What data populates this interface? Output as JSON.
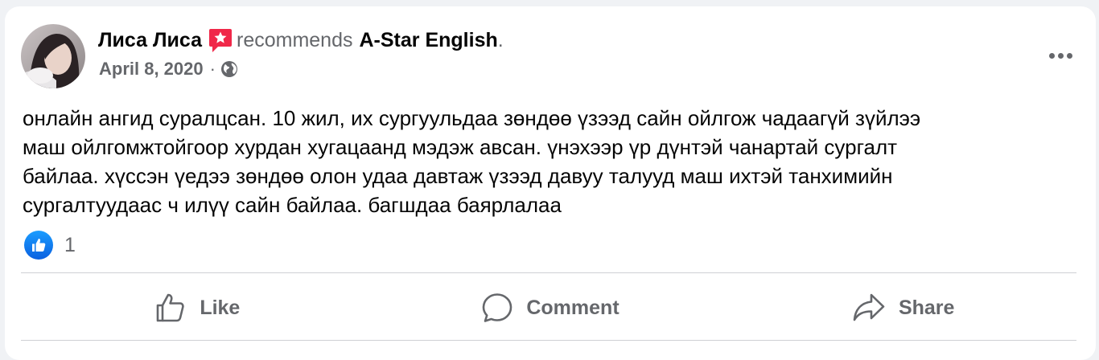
{
  "post": {
    "author": "Лиса Лиса",
    "verb": "recommends",
    "page": "A-Star English",
    "period": ".",
    "date": "April 8, 2020",
    "separator": "·",
    "body": "онлайн ангид суралцсан. 10 жил, их сургуульдаа зөндөө үзээд сайн ойлгож чадаагүй зүйлээ\nмаш ойлгомжтойгоор хурдан хугацаанд мэдэж авсан. үнэхээр үр дүнтэй чанартай сургалт\nбайлаа. хүссэн үедээ зөндөө олон удаа давтаж үзээд давуу талууд маш ихтэй танхимийн\nсургалтуудаас ч илүү сайн байлаа. багшдаа баярлалаа"
  },
  "reactions": {
    "count": "1",
    "type": "like"
  },
  "actions": {
    "like_label": "Like",
    "comment_label": "Comment",
    "share_label": "Share"
  },
  "icons": {
    "recommend": "recommend-star-icon",
    "privacy": "globe-icon",
    "more": "more-options-icon",
    "like": "thumbs-up-icon",
    "comment": "comment-icon",
    "share": "share-icon"
  },
  "colors": {
    "accent_blue": "#1877f2",
    "recommend_red": "#f02849",
    "secondary_text": "#65676b",
    "primary_text": "#050505"
  }
}
